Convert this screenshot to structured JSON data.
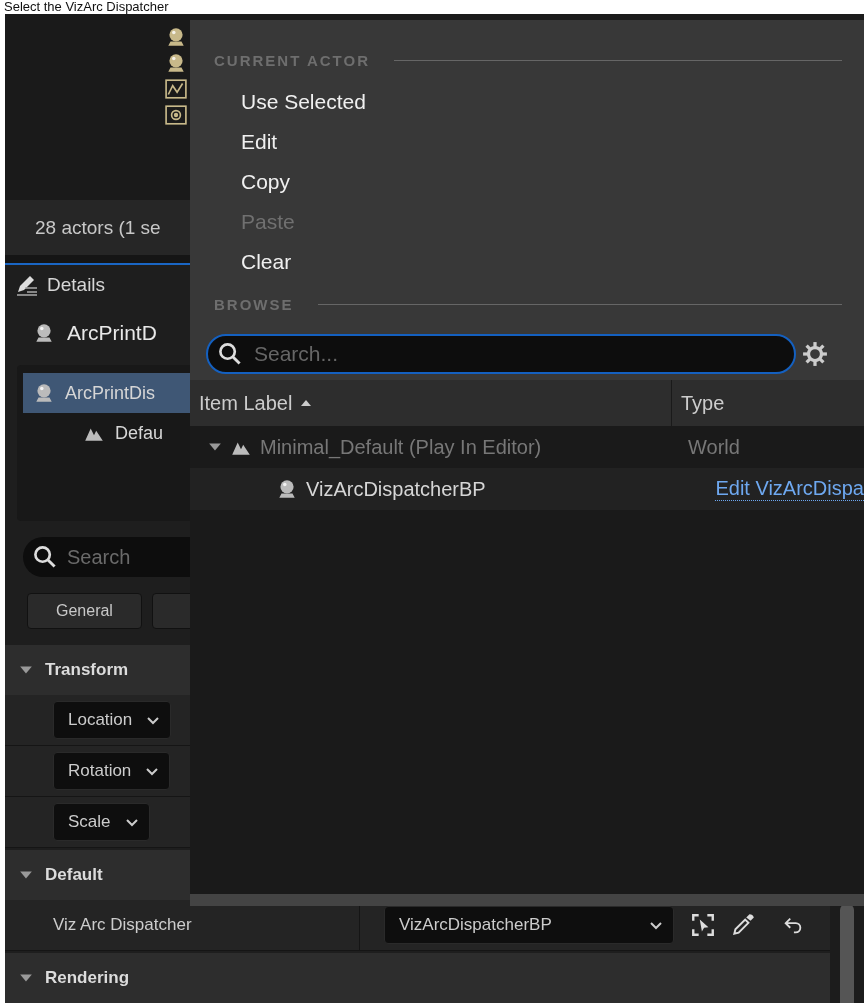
{
  "caption": "Select the VizArc Dispatcher",
  "outliner": {
    "status": "28 actors (1 se"
  },
  "details": {
    "tab": "Details",
    "actor_name": "ArcPrintD",
    "components": [
      {
        "label": "ArcPrintDis",
        "kind": "actor",
        "selected": true,
        "children": [
          {
            "label": "Defau",
            "kind": "scene",
            "selected": false
          }
        ]
      }
    ],
    "search": {
      "placeholder": "Search"
    },
    "filters": [
      "General"
    ],
    "categories": [
      {
        "label": "Transform",
        "expanded": true,
        "properties": [
          {
            "kind": "dropdown",
            "label": "Location"
          },
          {
            "kind": "dropdown",
            "label": "Rotation"
          },
          {
            "kind": "dropdown",
            "label": "Scale"
          }
        ]
      },
      {
        "label": "Default",
        "expanded": true,
        "properties": [
          {
            "kind": "object",
            "label": "Viz Arc Dispatcher",
            "value": "VizArcDispatcherBP"
          }
        ]
      },
      {
        "label": "Rendering",
        "expanded": true
      }
    ]
  },
  "popup": {
    "sections": [
      {
        "title": "CURRENT ACTOR",
        "items": [
          {
            "label": "Use Selected",
            "disabled": false
          },
          {
            "label": "Edit",
            "disabled": false
          },
          {
            "label": "Copy",
            "disabled": false
          },
          {
            "label": "Paste",
            "disabled": true
          },
          {
            "label": "Clear",
            "disabled": false
          }
        ]
      },
      {
        "title": "BROWSE"
      }
    ],
    "search": {
      "placeholder": "Search..."
    },
    "table": {
      "columns": [
        {
          "label": "Item Label",
          "sorted": true
        },
        {
          "label": "Type",
          "sorted": false
        }
      ],
      "rows": [
        {
          "kind": "world",
          "label": "Minimal_Default (Play In Editor)",
          "type": "World",
          "expanded": true,
          "children": [
            {
              "kind": "actor",
              "label": "VizArcDispatcherBP",
              "type": "Edit VizArcDispa"
            }
          ]
        }
      ]
    }
  }
}
